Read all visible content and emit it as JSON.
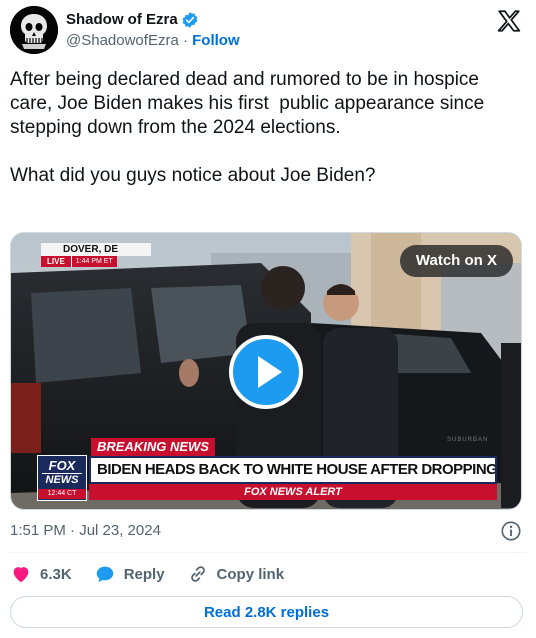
{
  "author": {
    "display_name": "Shadow of Ezra",
    "handle": "@ShadowofEzra",
    "separator": "·",
    "follow_label": "Follow",
    "verified_color": "#1d9bf0"
  },
  "tweet": {
    "text": "After being declared dead and rumored to be in hospice care, Joe Biden makes his first  public appearance since stepping down from the 2024 elections.\n\nWhat did you guys notice about Joe Biden?",
    "timestamp": "1:51 PM · Jul 23, 2024"
  },
  "media": {
    "watch_label": "Watch on X",
    "location": "DOVER, DE",
    "live_label": "LIVE",
    "live_time": "1:44 PM ET",
    "breaking_label": "BREAKING NEWS",
    "headline": "BIDEN HEADS BACK TO WHITE HOUSE AFTER DROPPING OUT",
    "alert_label": "FOX NEWS ALERT",
    "logo_line1": "FOX",
    "logo_line2": "NEWS",
    "logo_time": "12:44 CT",
    "vehicle_badge": "SUBURBAN"
  },
  "actions": {
    "like_count": "6.3K",
    "reply_label": "Reply",
    "copy_link_label": "Copy link",
    "read_replies_label": "Read 2.8K replies"
  },
  "colors": {
    "link_blue": "#006fd6",
    "heart": "#f91880",
    "reply_bubble": "#1d9bf0",
    "muted": "#536471"
  }
}
